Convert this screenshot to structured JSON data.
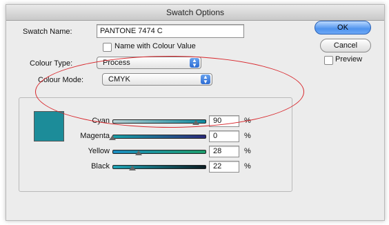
{
  "window": {
    "title": "Swatch Options"
  },
  "swatch_name": {
    "label": "Swatch Name:",
    "value": "PANTONE 7474 C"
  },
  "name_with_colour_value": {
    "label": "Name with Colour Value"
  },
  "colour_type": {
    "label": "Colour Type:",
    "value": "Process"
  },
  "colour_mode": {
    "label": "Colour Mode:",
    "value": "CMYK"
  },
  "swatch_color": "#1c8c99",
  "sliders": [
    {
      "label": "Cyan",
      "value": "90",
      "unit": "%",
      "gradient_start": "#b9d2d5",
      "gradient_end": "#0e8aa0"
    },
    {
      "label": "Magenta",
      "value": "0",
      "unit": "%",
      "gradient_start": "#17a0a8",
      "gradient_end": "#2a2a7a"
    },
    {
      "label": "Yellow",
      "value": "28",
      "unit": "%",
      "gradient_start": "#1b8cc0",
      "gradient_end": "#1c9c6a"
    },
    {
      "label": "Black",
      "value": "22",
      "unit": "%",
      "gradient_start": "#1ea3b5",
      "gradient_end": "#0a1c22"
    }
  ],
  "buttons": {
    "ok": "OK",
    "cancel": "Cancel"
  },
  "preview": {
    "label": "Preview"
  },
  "annotation_color": "#d8262b"
}
